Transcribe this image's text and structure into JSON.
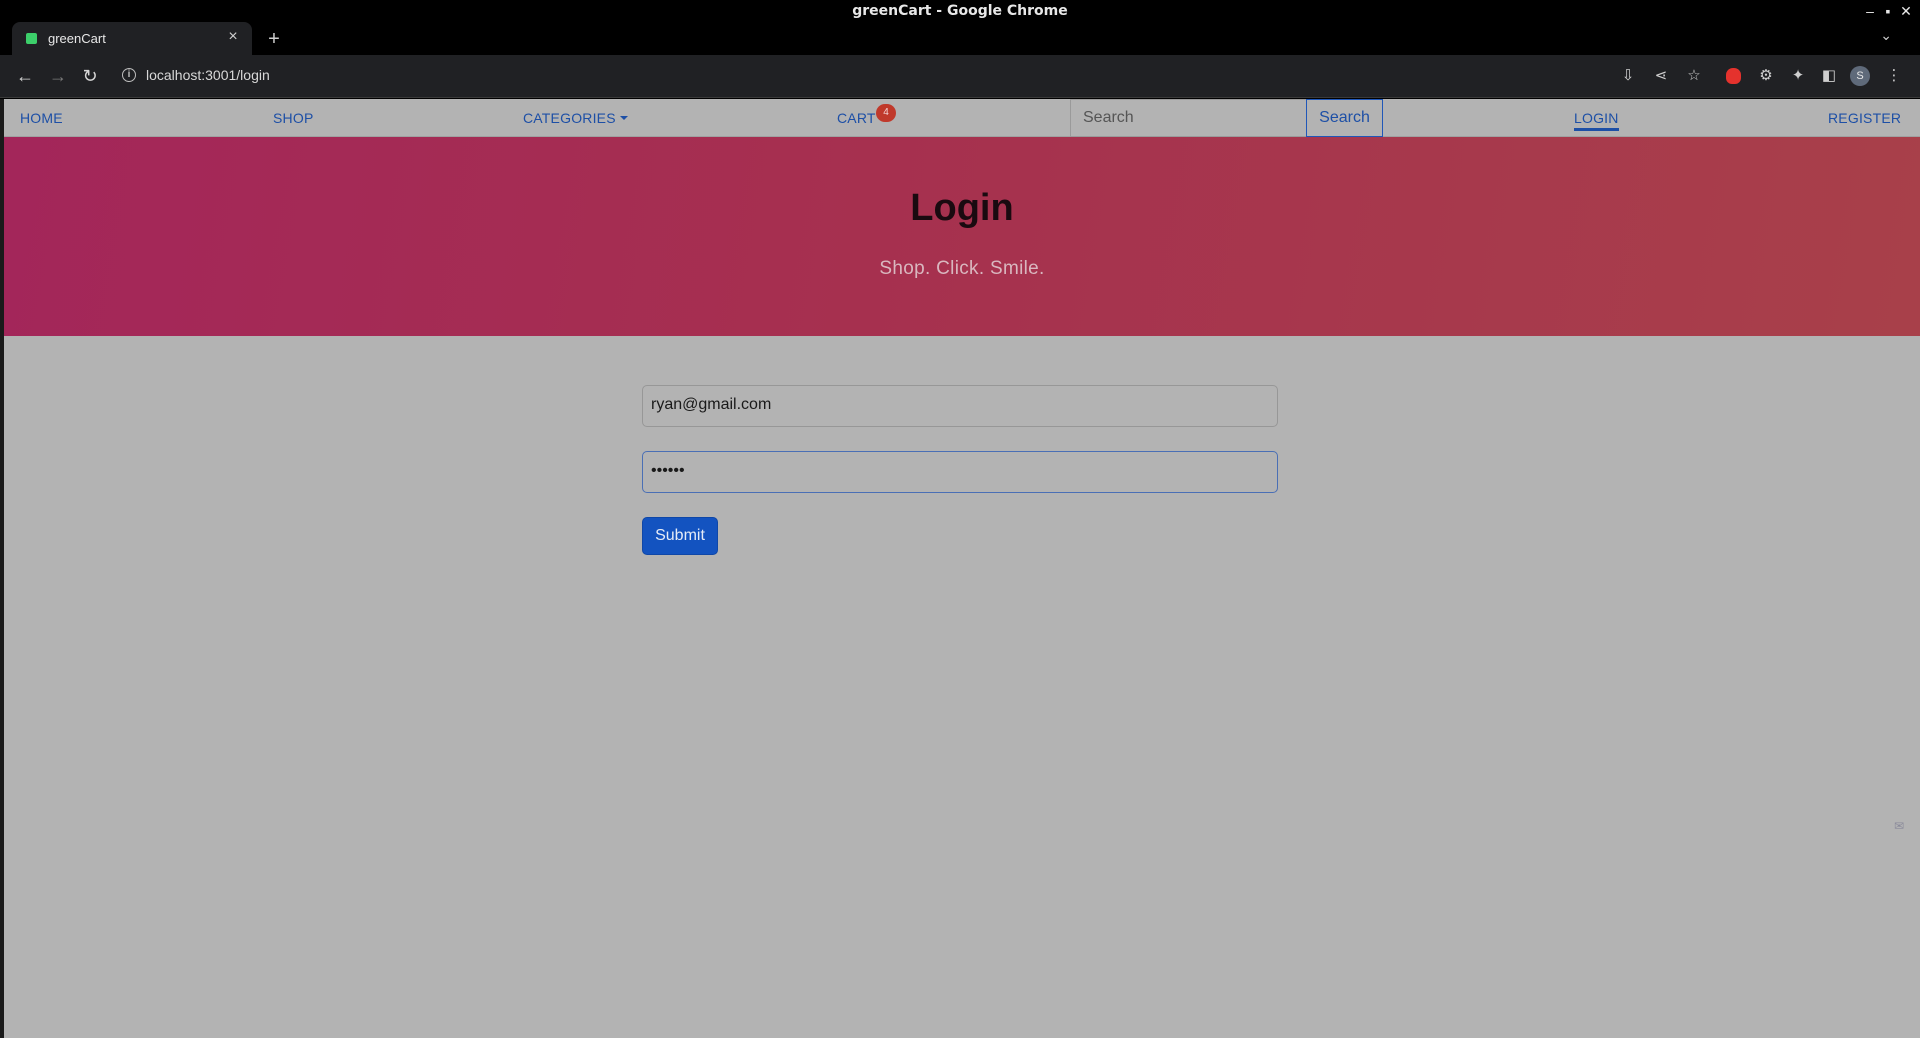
{
  "window": {
    "title": "greenCart - Google Chrome"
  },
  "tabs": [
    {
      "title": "greenCart",
      "active": true
    }
  ],
  "toolbar": {
    "url": "localhost:3001/login",
    "profile_initial": "S"
  },
  "site_nav": {
    "home": "HOME",
    "shop": "SHOP",
    "categories": "CATEGORIES",
    "cart": "CART",
    "cart_count": "4",
    "search_placeholder": "Search",
    "search_button": "Search",
    "login": "LOGIN",
    "register": "REGISTER",
    "active_item": "LOGIN"
  },
  "hero": {
    "title": "Login",
    "tagline": "Shop. Click. Smile."
  },
  "form": {
    "email_value": "ryan@gmail.com",
    "password_value": "••••••",
    "submit_label": "Submit"
  },
  "colors": {
    "link": "#1d4fa6",
    "hero_start": "#a3265a",
    "hero_end": "#a8404a",
    "submit": "#1353c0",
    "badge": "#c0392b"
  }
}
